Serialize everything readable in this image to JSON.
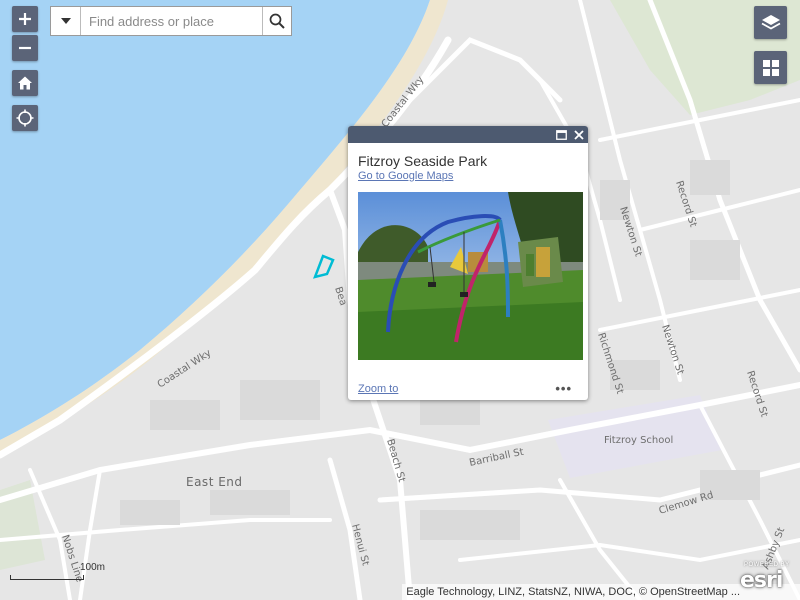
{
  "search": {
    "placeholder": "Find address or place"
  },
  "zoom": {
    "in_label": "+",
    "out_label": "−"
  },
  "map_labels": {
    "coastal_wky_top": "Coastal Wky",
    "coastal_wky_bottom": "Coastal Wky",
    "beach_st_top": "Bea",
    "beach_st_bottom": "Beach St",
    "newton_st_1": "Newton St",
    "newton_st_2": "Newton St",
    "record_st_1": "Record St",
    "record_st_2": "Record St",
    "richmond_st": "Richmond St",
    "barriball_st": "Barriball St",
    "fitzroy_school": "Fitzroy School",
    "clemow_rd": "Clemow Rd",
    "east_end": "East End",
    "henui_st": "Henui St",
    "nobs_line": "Nobs Line",
    "ashby_st": "Ashby St"
  },
  "popup": {
    "title": "Fitzroy Seaside Park",
    "google_link": "Go to Google Maps",
    "zoom_link": "Zoom to",
    "more": "•••"
  },
  "scale": {
    "label": "100m"
  },
  "attribution": {
    "text": "Eagle Technology, LINZ, StatsNZ, NIWA, DOC, © OpenStreetMap ..."
  },
  "logo": {
    "powered": "POWERED BY",
    "word": "esri"
  },
  "colors": {
    "water": "#a5d3f5",
    "land": "#e6e6e6",
    "road": "#ffffff",
    "control": "#5b6478",
    "popup_header": "#4d5a70",
    "link": "#5b76b5",
    "highlight": "#00bcd4"
  },
  "icons": {
    "zoom_in": "plus-icon",
    "zoom_out": "minus-icon",
    "home": "home-icon",
    "locate": "locate-icon",
    "layers": "layers-icon",
    "basemap": "grid-icon",
    "dropdown": "caret-down-icon",
    "search": "search-icon",
    "maximize": "maximize-icon",
    "close": "close-icon"
  }
}
